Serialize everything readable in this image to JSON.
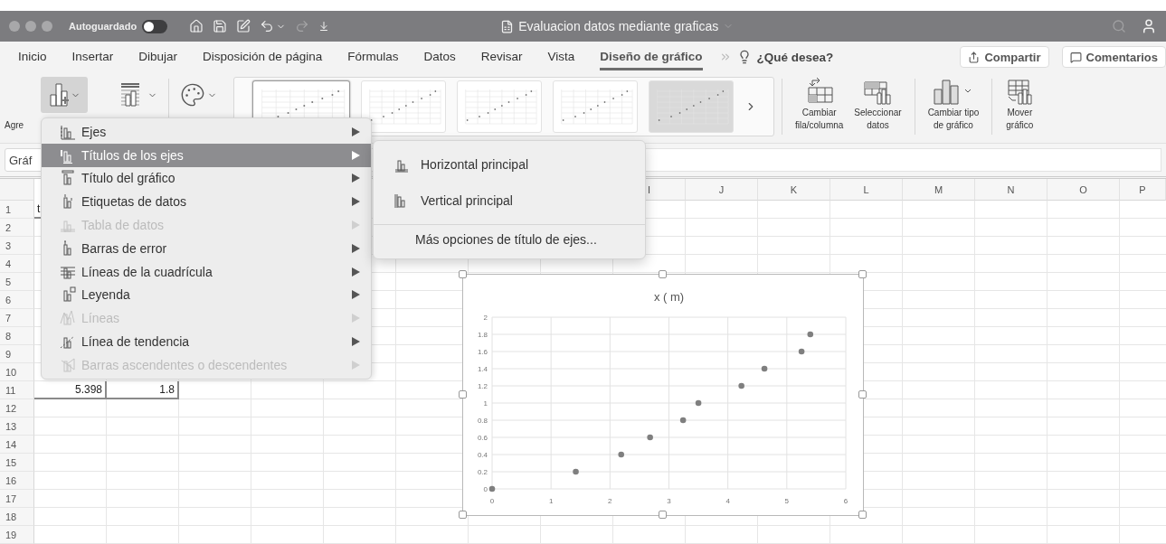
{
  "window": {
    "title": "Evaluacion datos mediante graficas",
    "autosave": {
      "label": "Autoguardado",
      "on": false
    }
  },
  "tabs": [
    {
      "label": "Inicio",
      "selected": false
    },
    {
      "label": "Insertar",
      "selected": false
    },
    {
      "label": "Dibujar",
      "selected": false
    },
    {
      "label": "Disposición de página",
      "selected": false
    },
    {
      "label": "Fórmulas",
      "selected": false
    },
    {
      "label": "Datos",
      "selected": false
    },
    {
      "label": "Revisar",
      "selected": false
    },
    {
      "label": "Vista",
      "selected": false
    },
    {
      "label": "Diseño de gráfico",
      "selected": true
    }
  ],
  "tell_me": "¿Qué desea?",
  "share_button": "Compartir",
  "comments_button": "Comentarios",
  "ribbon": {
    "add_element": {
      "label": "Agre",
      "pressed": true
    },
    "styles": [
      {
        "selected": true,
        "shaded": false
      },
      {
        "selected": false,
        "shaded": false
      },
      {
        "selected": false,
        "shaded": false
      },
      {
        "selected": false,
        "shaded": false
      },
      {
        "selected": false,
        "shaded": true
      }
    ],
    "commands": [
      {
        "lines": [
          "Cambiar",
          "fila/columna"
        ]
      },
      {
        "lines": [
          "Seleccionar",
          "datos"
        ]
      },
      {
        "lines": [
          "Cambiar tipo",
          "de gráfico"
        ]
      },
      {
        "lines": [
          "Mover",
          "gráfico"
        ]
      }
    ]
  },
  "name_box": "Gráf",
  "sheet": {
    "column_headers": [
      "I",
      "J",
      "K",
      "L",
      "M",
      "N",
      "O",
      "P"
    ],
    "rows": [
      {
        "number": "1",
        "cells": [
          {
            "text": "t",
            "kind": "text",
            "range": true
          }
        ]
      },
      {
        "number": "2",
        "cells": []
      },
      {
        "number": "3",
        "cells": []
      },
      {
        "number": "4",
        "cells": []
      },
      {
        "number": "5",
        "cells": []
      },
      {
        "number": "6",
        "cells": []
      },
      {
        "number": "7",
        "cells": []
      },
      {
        "number": "8",
        "cells": []
      },
      {
        "number": "9",
        "cells": []
      },
      {
        "number": "10",
        "cells": []
      },
      {
        "number": "11",
        "cells": [
          {
            "text": "5.398",
            "kind": "number",
            "range": true
          },
          {
            "text": "1.8",
            "kind": "number",
            "range": true
          }
        ]
      },
      {
        "number": "12",
        "cells": []
      },
      {
        "number": "13",
        "cells": []
      },
      {
        "number": "14",
        "cells": []
      },
      {
        "number": "15",
        "cells": []
      },
      {
        "number": "16",
        "cells": []
      },
      {
        "number": "17",
        "cells": []
      },
      {
        "number": "18",
        "cells": []
      },
      {
        "number": "19",
        "cells": []
      }
    ]
  },
  "menu": {
    "items": [
      {
        "label": "Ejes",
        "disabled": false,
        "selected": false
      },
      {
        "label": "Títulos de los ejes",
        "disabled": false,
        "selected": true
      },
      {
        "label": "Título del gráfico",
        "disabled": false,
        "selected": false
      },
      {
        "label": "Etiquetas de datos",
        "disabled": false,
        "selected": false
      },
      {
        "label": "Tabla de datos",
        "disabled": true,
        "selected": false
      },
      {
        "label": "Barras de error",
        "disabled": false,
        "selected": false
      },
      {
        "label": "Líneas de la cuadrícula",
        "disabled": false,
        "selected": false
      },
      {
        "label": "Leyenda",
        "disabled": false,
        "selected": false
      },
      {
        "label": "Líneas",
        "disabled": true,
        "selected": false
      },
      {
        "label": "Línea de tendencia",
        "disabled": false,
        "selected": false
      },
      {
        "label": "Barras ascendentes o descendentes",
        "disabled": true,
        "selected": false
      }
    ]
  },
  "submenu": {
    "items": [
      {
        "label": "Horizontal principal",
        "kind": "icon"
      },
      {
        "label": "Vertical principal",
        "kind": "icon"
      },
      {
        "label": "Más opciones de título de ejes...",
        "kind": "plain"
      }
    ]
  },
  "chart": {
    "chart_data": {
      "type": "scatter",
      "title": "x ( m)",
      "grid": true,
      "x": [
        0,
        1.42,
        2.19,
        2.68,
        3.24,
        3.5,
        4.23,
        4.62,
        5.25,
        5.398
      ],
      "series": [
        {
          "color": "#7f7f7f",
          "values": [
            0,
            0.2,
            0.4,
            0.6,
            0.8,
            1,
            1.2,
            1.4,
            1.6,
            1.8
          ]
        }
      ],
      "xlim": [
        0,
        6
      ],
      "ylim": [
        0,
        2
      ],
      "xticks": [
        0,
        1,
        2,
        3,
        4,
        5,
        6
      ],
      "yticks": [
        0,
        0.2,
        0.4,
        0.6,
        0.8,
        1,
        1.2,
        1.4,
        1.6,
        1.8,
        2
      ]
    }
  }
}
